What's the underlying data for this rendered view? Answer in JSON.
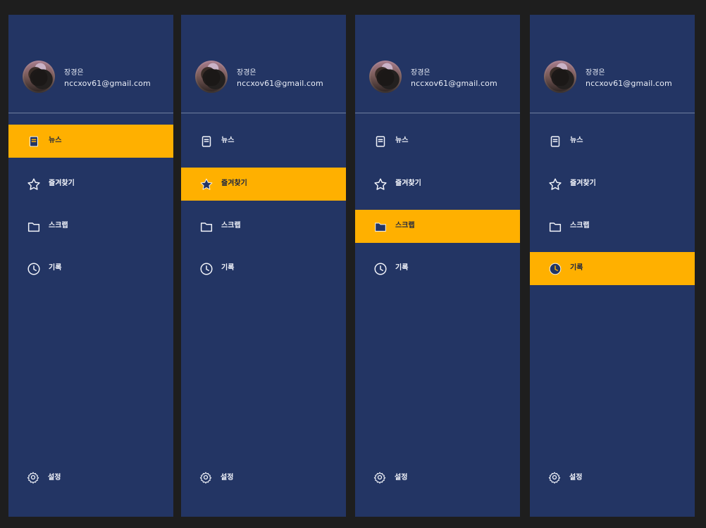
{
  "user": {
    "name": "장경은",
    "email": "nccxov61@gmail.com"
  },
  "menu": {
    "items": [
      {
        "label": "뉴스",
        "icon": "news-icon"
      },
      {
        "label": "즐겨찾기",
        "icon": "star-icon"
      },
      {
        "label": "스크랩",
        "icon": "folder-icon"
      },
      {
        "label": "기록",
        "icon": "clock-icon"
      }
    ],
    "settings": {
      "label": "설정",
      "icon": "gear-icon"
    }
  },
  "colors": {
    "background": "#1e1e1e",
    "drawer": "#233564",
    "accent": "#ffb000",
    "text": "#f3f5fb"
  }
}
